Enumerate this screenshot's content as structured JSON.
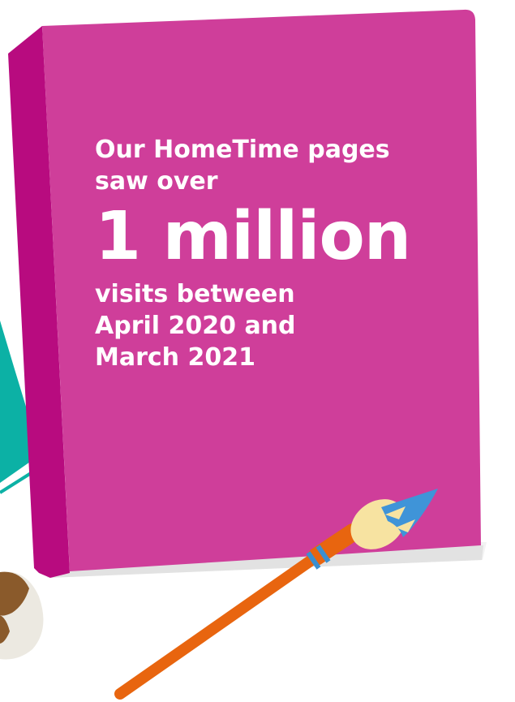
{
  "book": {
    "intro": "Our HomeTime pages saw over",
    "figure": "1 million",
    "outro": "visits between April 2020 and March 2021"
  },
  "colors": {
    "book_cover": "#cf3e9a",
    "book_spine": "#b80b7f",
    "teal_shape": "#0cb1a5",
    "brush_handle": "#e8650f",
    "brush_band": "#3b8fcf",
    "brush_tip": "#f7e3a1",
    "brush_paint": "#3f94d8",
    "pot_brown": "#8a5a2b",
    "pot_cream": "#ece9e1"
  }
}
